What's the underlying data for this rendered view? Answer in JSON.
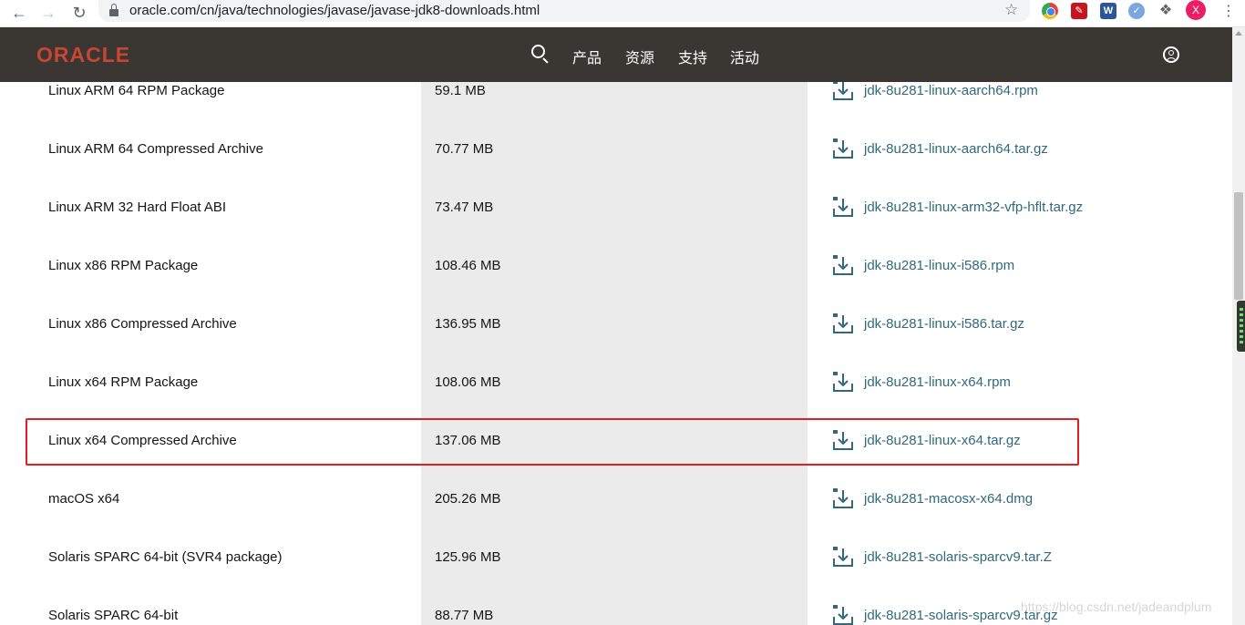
{
  "browser": {
    "url": "oracle.com/cn/java/technologies/javase/javase-jdk8-downloads.html",
    "avatar_letter": "X"
  },
  "header": {
    "logo": "ORACLE",
    "nav": [
      "产品",
      "资源",
      "支持",
      "活动"
    ],
    "logo_color": "#c74634",
    "bg_color": "#3a3632"
  },
  "downloads": [
    {
      "product": "Linux ARM 64 RPM Package",
      "size": "59.1 MB",
      "file": "jdk-8u281-linux-aarch64.rpm"
    },
    {
      "product": "Linux ARM 64 Compressed Archive",
      "size": "70.77 MB",
      "file": "jdk-8u281-linux-aarch64.tar.gz"
    },
    {
      "product": "Linux ARM 32 Hard Float ABI",
      "size": "73.47 MB",
      "file": "jdk-8u281-linux-arm32-vfp-hflt.tar.gz"
    },
    {
      "product": "Linux x86 RPM Package",
      "size": "108.46 MB",
      "file": "jdk-8u281-linux-i586.rpm"
    },
    {
      "product": "Linux x86 Compressed Archive",
      "size": "136.95 MB",
      "file": "jdk-8u281-linux-i586.tar.gz"
    },
    {
      "product": "Linux x64 RPM Package",
      "size": "108.06 MB",
      "file": "jdk-8u281-linux-x64.rpm"
    },
    {
      "product": "Linux x64 Compressed Archive",
      "size": "137.06 MB",
      "file": "jdk-8u281-linux-x64.tar.gz",
      "highlighted": true
    },
    {
      "product": "macOS x64",
      "size": "205.26 MB",
      "file": "jdk-8u281-macosx-x64.dmg"
    },
    {
      "product": "Solaris SPARC 64-bit (SVR4 package)",
      "size": "125.96 MB",
      "file": "jdk-8u281-solaris-sparcv9.tar.Z"
    },
    {
      "product": "Solaris SPARC 64-bit",
      "size": "88.77 MB",
      "file": "jdk-8u281-solaris-sparcv9.tar.gz"
    }
  ],
  "link_color": "#31697a",
  "highlight_color": "#e02020",
  "watermark": "https://blog.csdn.net/jadeandplum"
}
